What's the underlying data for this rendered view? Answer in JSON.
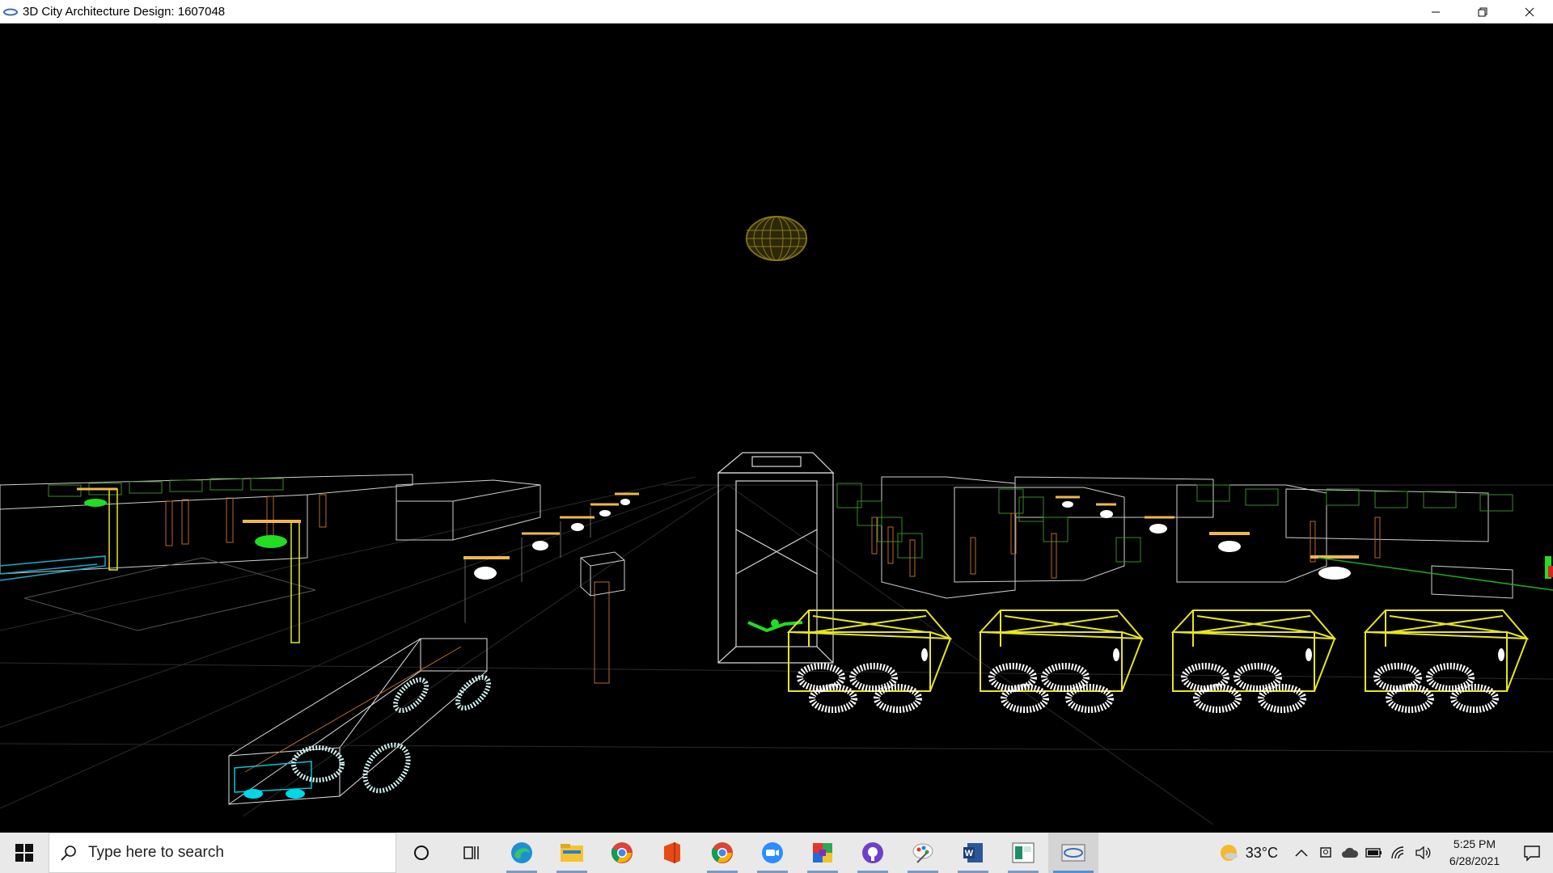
{
  "window": {
    "title": "3D City Architecture Design: 1607048",
    "controls": {
      "minimize": "minimize-icon",
      "restore": "restore-icon",
      "close": "close-icon"
    }
  },
  "scene": {
    "background": "#000000",
    "colors": {
      "sun": "#8a7a1a",
      "building": "#d8d8d8",
      "tree": "#3c8a2a",
      "bus": "#e6e620",
      "wheel": "#ffffff",
      "lamp": "#f0b84a",
      "car": "#00c8d8",
      "grass": "#22cc22",
      "pole": "#b86a2a"
    },
    "objects": [
      "sun",
      "buildings",
      "street-lamps",
      "buses",
      "car",
      "trees",
      "road-grid"
    ]
  },
  "taskbar": {
    "search_placeholder": "Type here to search",
    "apps": [
      "cortana-icon",
      "task-view-icon",
      "edge-icon",
      "file-explorer-icon",
      "chrome-icon",
      "office-icon",
      "chrome-icon",
      "zoom-icon",
      "colorful-app-icon",
      "github-icon",
      "paint-app-icon",
      "word-icon",
      "app-icon",
      "opengl-app-icon"
    ],
    "weather": {
      "temperature": "33°C"
    },
    "clock": {
      "time": "5:25 PM",
      "date": "6/28/2021"
    }
  }
}
